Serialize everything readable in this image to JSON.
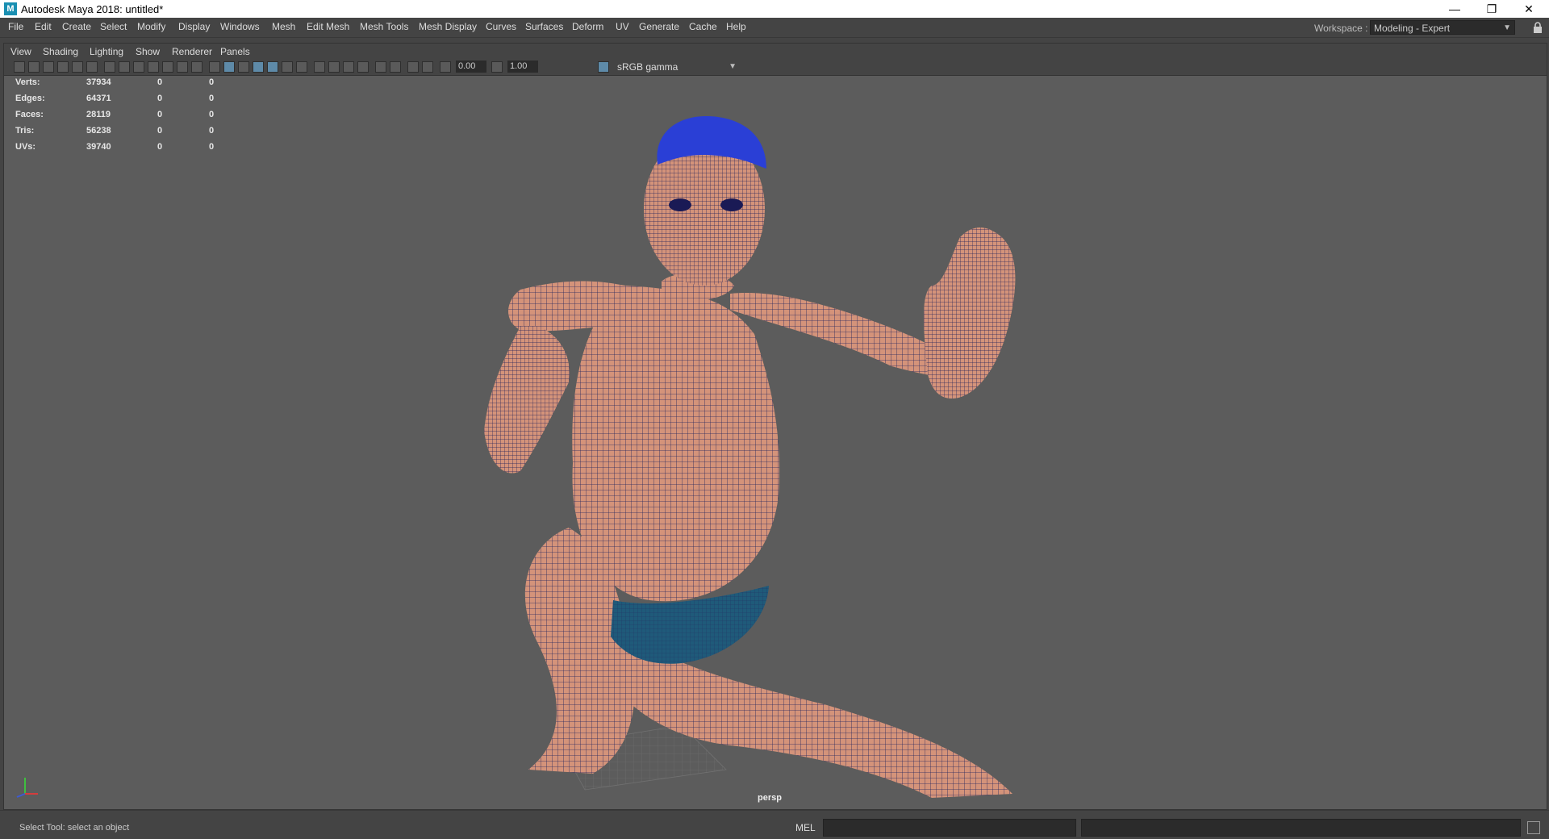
{
  "window": {
    "title": "Autodesk Maya 2018: untitled*",
    "app_icon_letter": "M",
    "controls": [
      "minimize-icon",
      "restore-icon",
      "close-icon"
    ]
  },
  "menubar": {
    "items": [
      "File",
      "Edit",
      "Create",
      "Select",
      "Modify",
      "Display",
      "Windows",
      "Mesh",
      "Edit Mesh",
      "Mesh Tools",
      "Mesh Display",
      "Curves",
      "Surfaces",
      "Deform",
      "UV",
      "Generate",
      "Cache",
      "Help"
    ],
    "workspace_label": "Workspace :",
    "workspace_value": "Modeling - Expert"
  },
  "panel": {
    "menu": [
      "View",
      "Shading",
      "Lighting",
      "Show",
      "Renderer",
      "Panels"
    ],
    "exposure": "0.00",
    "gamma": "1.00",
    "color_space": "sRGB gamma",
    "camera": "persp"
  },
  "hud": {
    "rows": [
      {
        "label": "Verts:",
        "value": "37934",
        "col2": "0",
        "col3": "0"
      },
      {
        "label": "Edges:",
        "value": "64371",
        "col2": "0",
        "col3": "0"
      },
      {
        "label": "Faces:",
        "value": "28119",
        "col2": "0",
        "col3": "0"
      },
      {
        "label": "Tris:",
        "value": "56238",
        "col2": "0",
        "col3": "0"
      },
      {
        "label": "UVs:",
        "value": "39740",
        "col2": "0",
        "col3": "0"
      }
    ]
  },
  "status": {
    "help_line": "Select Tool: select an object",
    "command_language": "MEL"
  },
  "colors": {
    "skin": "#d4937a",
    "wire": "#1a1a6e",
    "hair": "#2a3fd6",
    "shorts": "#1f5a7a",
    "viewport_bg": "#5c5c5c"
  }
}
